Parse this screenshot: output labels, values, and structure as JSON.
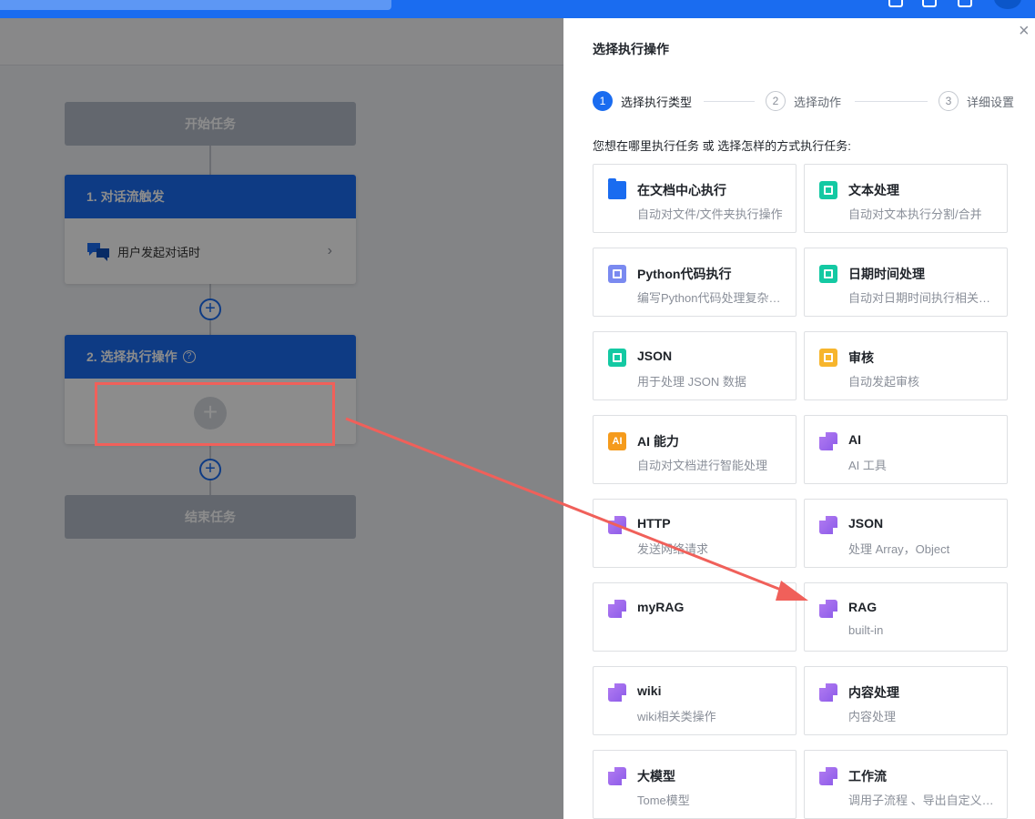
{
  "flow": {
    "start_label": "开始任务",
    "trigger_title": "1. 对话流触发",
    "trigger_body": "用户发起对话时",
    "action_title": "2. 选择执行操作",
    "end_label": "结束任务"
  },
  "panel": {
    "title": "选择执行操作",
    "close_symbol": "×",
    "steps": [
      {
        "num": "1",
        "label": "选择执行类型"
      },
      {
        "num": "2",
        "label": "选择动作"
      },
      {
        "num": "3",
        "label": "详细设置"
      }
    ],
    "prompt": "您想在哪里执行任务 或 选择怎样的方式执行任务:",
    "cards": [
      {
        "title": "在文档中心执行",
        "desc": "自动对文件/文件夹执行操作",
        "icon": "folder-icon"
      },
      {
        "title": "文本处理",
        "desc": "自动对文本执行分割/合并",
        "icon": "text-scan-icon"
      },
      {
        "title": "Python代码执行",
        "desc": "编写Python代码处理复杂逻辑",
        "icon": "code-icon"
      },
      {
        "title": "日期时间处理",
        "desc": "自动对日期时间执行相关操作",
        "icon": "calendar-icon"
      },
      {
        "title": "JSON",
        "desc": "用于处理 JSON 数据",
        "icon": "database-icon"
      },
      {
        "title": "审核",
        "desc": "自动发起审核",
        "icon": "approval-icon"
      },
      {
        "title": "AI 能力",
        "desc": "自动对文档进行智能处理",
        "icon": "ai-badge-icon",
        "badge": "AI"
      },
      {
        "title": "AI",
        "desc": "AI 工具",
        "icon": "plugin-icon"
      },
      {
        "title": "HTTP",
        "desc": "发送网络请求",
        "icon": "plugin-icon"
      },
      {
        "title": "JSON",
        "desc": "处理 Array，Object",
        "icon": "plugin-icon"
      },
      {
        "title": "myRAG",
        "desc": "",
        "icon": "plugin-icon"
      },
      {
        "title": "RAG",
        "desc": "built-in",
        "icon": "plugin-icon"
      },
      {
        "title": "wiki",
        "desc": "wiki相关类操作",
        "icon": "plugin-icon"
      },
      {
        "title": "内容处理",
        "desc": "内容处理",
        "icon": "plugin-icon"
      },
      {
        "title": "大模型",
        "desc": "Tome模型",
        "icon": "plugin-icon"
      },
      {
        "title": "工作流",
        "desc": "调用子流程 、导出自定义工作流",
        "icon": "plugin-icon"
      }
    ]
  },
  "colors": {
    "primary": "#1a6cf0",
    "annotation": "#f0605a"
  }
}
